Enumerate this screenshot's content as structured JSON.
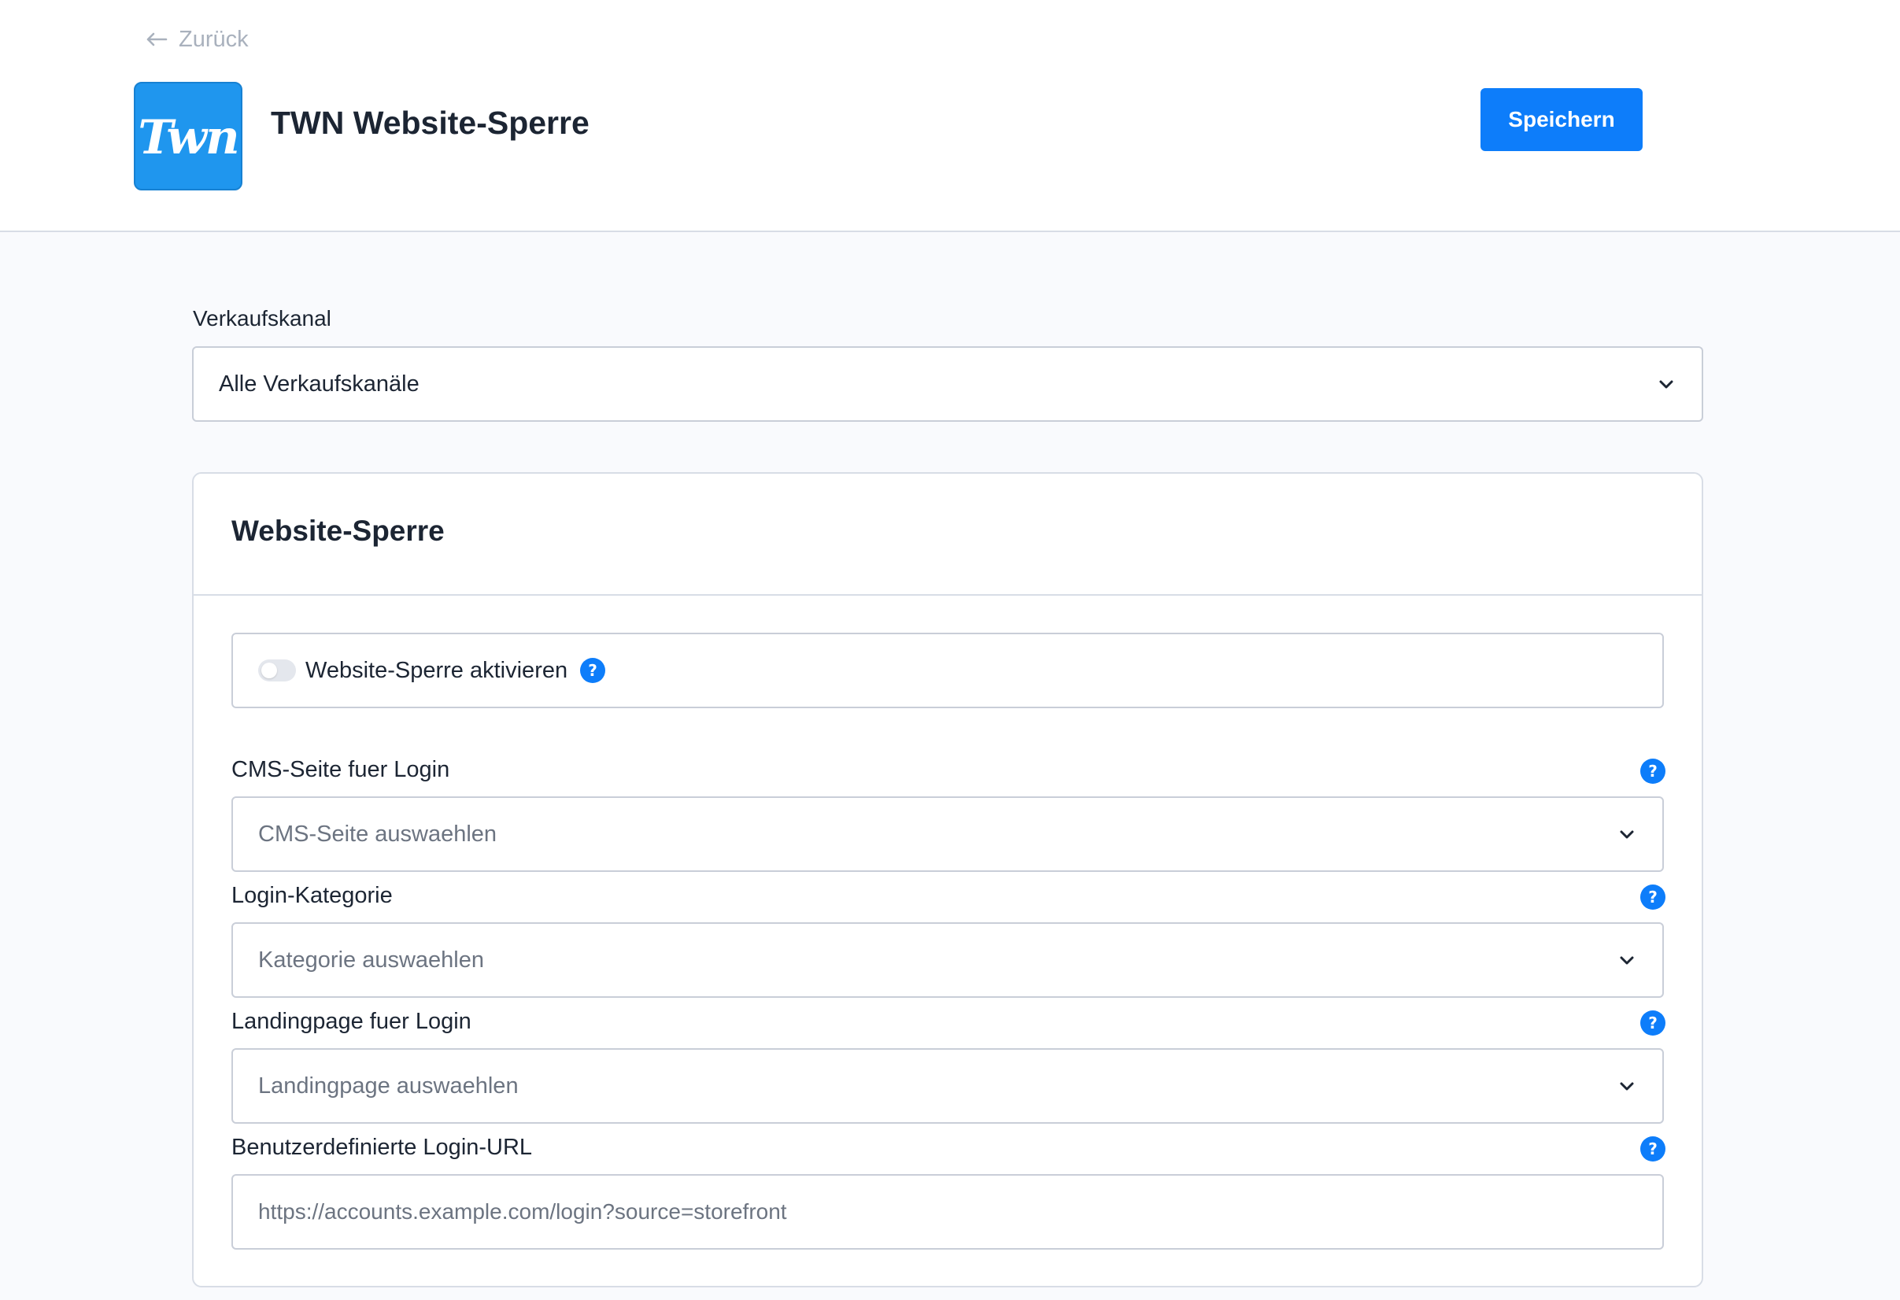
{
  "header": {
    "back_label": "Zurück",
    "app_logo_text": "Twn",
    "app_title": "TWN Website-Sperre",
    "save_label": "Speichern"
  },
  "sales_channel": {
    "label": "Verkaufskanal",
    "selected": "Alle Verkaufskanäle"
  },
  "card": {
    "title": "Website-Sperre",
    "toggle": {
      "label": "Website-Sperre aktivieren",
      "enabled": false
    },
    "fields": [
      {
        "label": "CMS-Seite fuer Login",
        "placeholder": "CMS-Seite auswaehlen"
      },
      {
        "label": "Login-Kategorie",
        "placeholder": "Kategorie auswaehlen"
      },
      {
        "label": "Landingpage fuer Login",
        "placeholder": "Landingpage auswaehlen"
      },
      {
        "label": "Benutzerdefinierte Login-URL",
        "placeholder": "https://accounts.example.com/login?source=storefront"
      }
    ]
  },
  "help_symbol": "?",
  "colors": {
    "accent": "#0d7dfa",
    "logo_bg": "#1f96ee",
    "page_bg": "#f9fafd"
  }
}
